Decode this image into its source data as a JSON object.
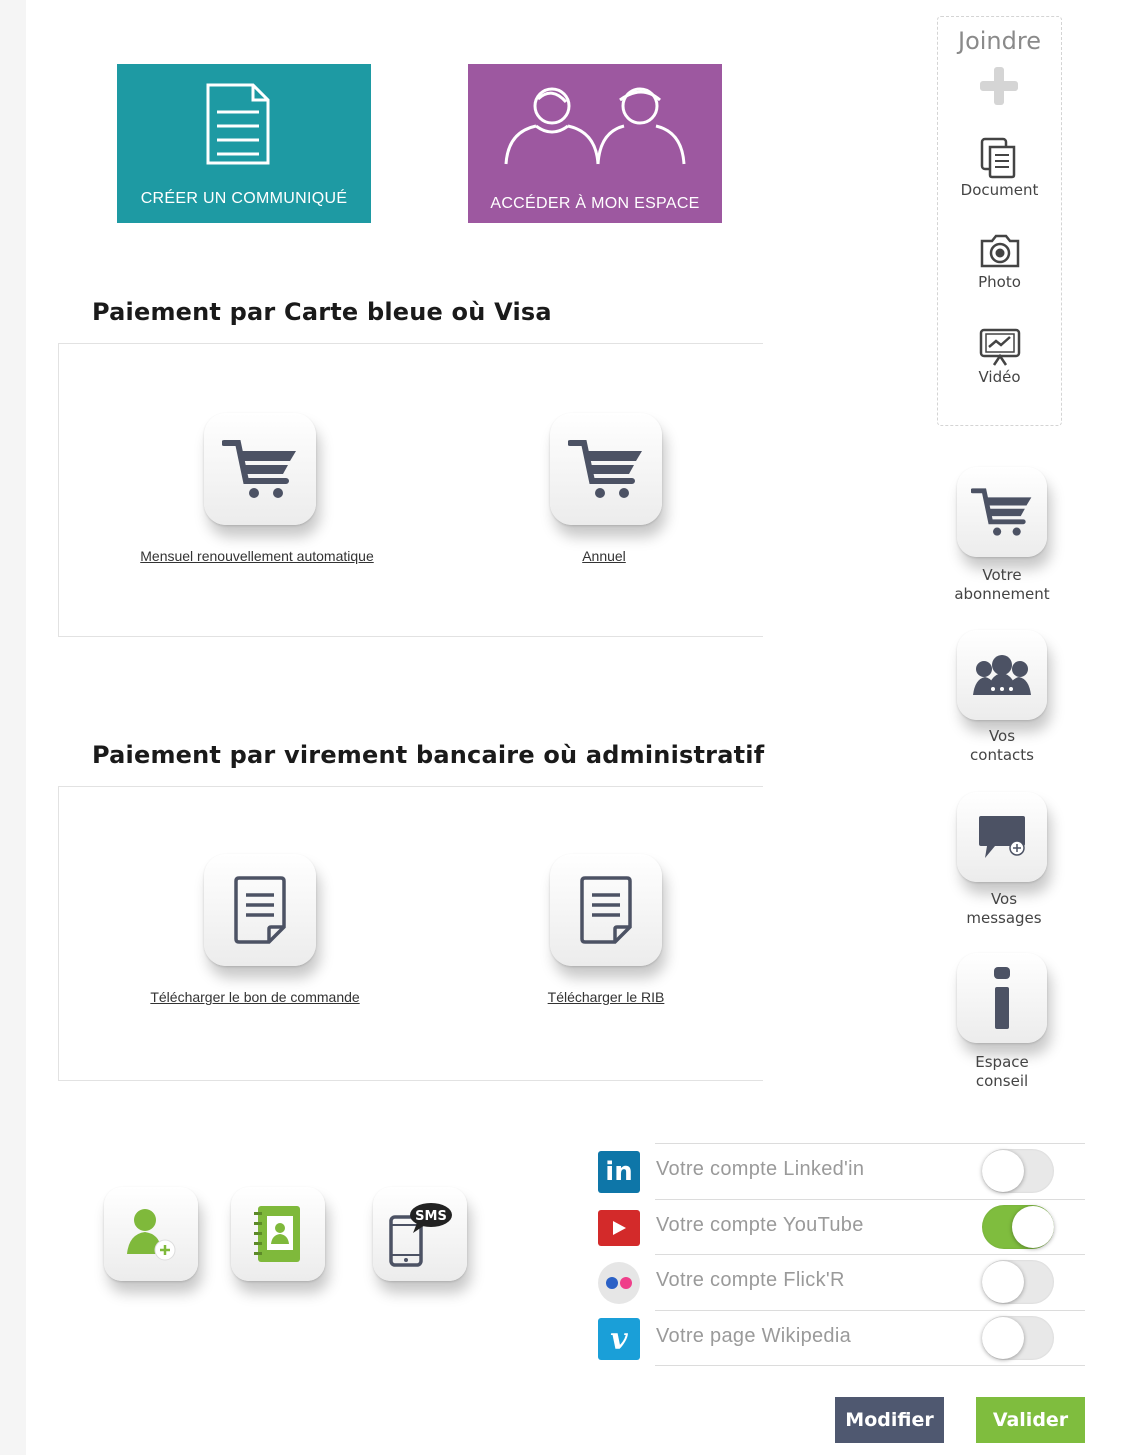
{
  "tiles": {
    "create_label": "CRÉER UN COMMUNIQUÉ",
    "space_label": "ACCÉDER À MON ESPACE"
  },
  "card_payment": {
    "title": "Paiement par Carte bleue où Visa",
    "monthly": "Mensuel renouvellement automatique",
    "annual": "Annuel"
  },
  "transfer_payment": {
    "title": "Paiement par virement bancaire où administratif",
    "order_form": "Télécharger le bon de commande",
    "rib": "Télécharger le RIB"
  },
  "attach": {
    "title": "Joindre",
    "document": "Document",
    "photo": "Photo",
    "video": "Vidéo"
  },
  "sidebar": {
    "subscription": [
      "Votre",
      "abonnement"
    ],
    "contacts": [
      "Vos",
      "contacts"
    ],
    "messages": [
      "Vos",
      "messages"
    ],
    "advice": [
      "Espace",
      "conseil"
    ]
  },
  "social": [
    {
      "label": "Votre compte Linked'in",
      "on": false,
      "color": "#0e76a8"
    },
    {
      "label": "Votre compte YouTube",
      "on": true,
      "color": "#d32a2a"
    },
    {
      "label": "Votre compte Flick'R",
      "on": false,
      "color": "#dedede"
    },
    {
      "label": "Votre page Wikipedia",
      "on": false,
      "color": "#1a9fd8"
    }
  ],
  "sms_badge": "SMS",
  "buttons": {
    "modify": "Modifier",
    "validate": "Valider"
  },
  "colors": {
    "teal": "#1e9aa3",
    "purple": "#9d58a0",
    "icon_gray": "#4c5264",
    "green": "#7fbd3e",
    "slate": "#4f5870"
  }
}
